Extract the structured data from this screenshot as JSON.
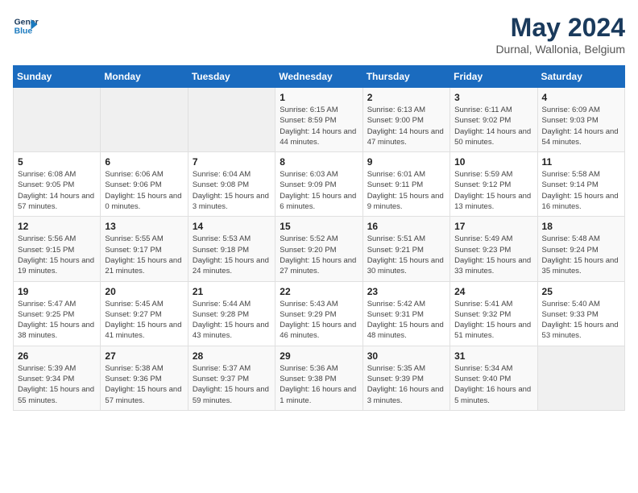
{
  "header": {
    "logo_line1": "General",
    "logo_line2": "Blue",
    "month": "May 2024",
    "location": "Durnal, Wallonia, Belgium"
  },
  "weekdays": [
    "Sunday",
    "Monday",
    "Tuesday",
    "Wednesday",
    "Thursday",
    "Friday",
    "Saturday"
  ],
  "weeks": [
    [
      {
        "day": "",
        "sunrise": "",
        "sunset": "",
        "daylight": ""
      },
      {
        "day": "",
        "sunrise": "",
        "sunset": "",
        "daylight": ""
      },
      {
        "day": "",
        "sunrise": "",
        "sunset": "",
        "daylight": ""
      },
      {
        "day": "1",
        "sunrise": "Sunrise: 6:15 AM",
        "sunset": "Sunset: 8:59 PM",
        "daylight": "Daylight: 14 hours and 44 minutes."
      },
      {
        "day": "2",
        "sunrise": "Sunrise: 6:13 AM",
        "sunset": "Sunset: 9:00 PM",
        "daylight": "Daylight: 14 hours and 47 minutes."
      },
      {
        "day": "3",
        "sunrise": "Sunrise: 6:11 AM",
        "sunset": "Sunset: 9:02 PM",
        "daylight": "Daylight: 14 hours and 50 minutes."
      },
      {
        "day": "4",
        "sunrise": "Sunrise: 6:09 AM",
        "sunset": "Sunset: 9:03 PM",
        "daylight": "Daylight: 14 hours and 54 minutes."
      }
    ],
    [
      {
        "day": "5",
        "sunrise": "Sunrise: 6:08 AM",
        "sunset": "Sunset: 9:05 PM",
        "daylight": "Daylight: 14 hours and 57 minutes."
      },
      {
        "day": "6",
        "sunrise": "Sunrise: 6:06 AM",
        "sunset": "Sunset: 9:06 PM",
        "daylight": "Daylight: 15 hours and 0 minutes."
      },
      {
        "day": "7",
        "sunrise": "Sunrise: 6:04 AM",
        "sunset": "Sunset: 9:08 PM",
        "daylight": "Daylight: 15 hours and 3 minutes."
      },
      {
        "day": "8",
        "sunrise": "Sunrise: 6:03 AM",
        "sunset": "Sunset: 9:09 PM",
        "daylight": "Daylight: 15 hours and 6 minutes."
      },
      {
        "day": "9",
        "sunrise": "Sunrise: 6:01 AM",
        "sunset": "Sunset: 9:11 PM",
        "daylight": "Daylight: 15 hours and 9 minutes."
      },
      {
        "day": "10",
        "sunrise": "Sunrise: 5:59 AM",
        "sunset": "Sunset: 9:12 PM",
        "daylight": "Daylight: 15 hours and 13 minutes."
      },
      {
        "day": "11",
        "sunrise": "Sunrise: 5:58 AM",
        "sunset": "Sunset: 9:14 PM",
        "daylight": "Daylight: 15 hours and 16 minutes."
      }
    ],
    [
      {
        "day": "12",
        "sunrise": "Sunrise: 5:56 AM",
        "sunset": "Sunset: 9:15 PM",
        "daylight": "Daylight: 15 hours and 19 minutes."
      },
      {
        "day": "13",
        "sunrise": "Sunrise: 5:55 AM",
        "sunset": "Sunset: 9:17 PM",
        "daylight": "Daylight: 15 hours and 21 minutes."
      },
      {
        "day": "14",
        "sunrise": "Sunrise: 5:53 AM",
        "sunset": "Sunset: 9:18 PM",
        "daylight": "Daylight: 15 hours and 24 minutes."
      },
      {
        "day": "15",
        "sunrise": "Sunrise: 5:52 AM",
        "sunset": "Sunset: 9:20 PM",
        "daylight": "Daylight: 15 hours and 27 minutes."
      },
      {
        "day": "16",
        "sunrise": "Sunrise: 5:51 AM",
        "sunset": "Sunset: 9:21 PM",
        "daylight": "Daylight: 15 hours and 30 minutes."
      },
      {
        "day": "17",
        "sunrise": "Sunrise: 5:49 AM",
        "sunset": "Sunset: 9:23 PM",
        "daylight": "Daylight: 15 hours and 33 minutes."
      },
      {
        "day": "18",
        "sunrise": "Sunrise: 5:48 AM",
        "sunset": "Sunset: 9:24 PM",
        "daylight": "Daylight: 15 hours and 35 minutes."
      }
    ],
    [
      {
        "day": "19",
        "sunrise": "Sunrise: 5:47 AM",
        "sunset": "Sunset: 9:25 PM",
        "daylight": "Daylight: 15 hours and 38 minutes."
      },
      {
        "day": "20",
        "sunrise": "Sunrise: 5:45 AM",
        "sunset": "Sunset: 9:27 PM",
        "daylight": "Daylight: 15 hours and 41 minutes."
      },
      {
        "day": "21",
        "sunrise": "Sunrise: 5:44 AM",
        "sunset": "Sunset: 9:28 PM",
        "daylight": "Daylight: 15 hours and 43 minutes."
      },
      {
        "day": "22",
        "sunrise": "Sunrise: 5:43 AM",
        "sunset": "Sunset: 9:29 PM",
        "daylight": "Daylight: 15 hours and 46 minutes."
      },
      {
        "day": "23",
        "sunrise": "Sunrise: 5:42 AM",
        "sunset": "Sunset: 9:31 PM",
        "daylight": "Daylight: 15 hours and 48 minutes."
      },
      {
        "day": "24",
        "sunrise": "Sunrise: 5:41 AM",
        "sunset": "Sunset: 9:32 PM",
        "daylight": "Daylight: 15 hours and 51 minutes."
      },
      {
        "day": "25",
        "sunrise": "Sunrise: 5:40 AM",
        "sunset": "Sunset: 9:33 PM",
        "daylight": "Daylight: 15 hours and 53 minutes."
      }
    ],
    [
      {
        "day": "26",
        "sunrise": "Sunrise: 5:39 AM",
        "sunset": "Sunset: 9:34 PM",
        "daylight": "Daylight: 15 hours and 55 minutes."
      },
      {
        "day": "27",
        "sunrise": "Sunrise: 5:38 AM",
        "sunset": "Sunset: 9:36 PM",
        "daylight": "Daylight: 15 hours and 57 minutes."
      },
      {
        "day": "28",
        "sunrise": "Sunrise: 5:37 AM",
        "sunset": "Sunset: 9:37 PM",
        "daylight": "Daylight: 15 hours and 59 minutes."
      },
      {
        "day": "29",
        "sunrise": "Sunrise: 5:36 AM",
        "sunset": "Sunset: 9:38 PM",
        "daylight": "Daylight: 16 hours and 1 minute."
      },
      {
        "day": "30",
        "sunrise": "Sunrise: 5:35 AM",
        "sunset": "Sunset: 9:39 PM",
        "daylight": "Daylight: 16 hours and 3 minutes."
      },
      {
        "day": "31",
        "sunrise": "Sunrise: 5:34 AM",
        "sunset": "Sunset: 9:40 PM",
        "daylight": "Daylight: 16 hours and 5 minutes."
      },
      {
        "day": "",
        "sunrise": "",
        "sunset": "",
        "daylight": ""
      }
    ]
  ]
}
